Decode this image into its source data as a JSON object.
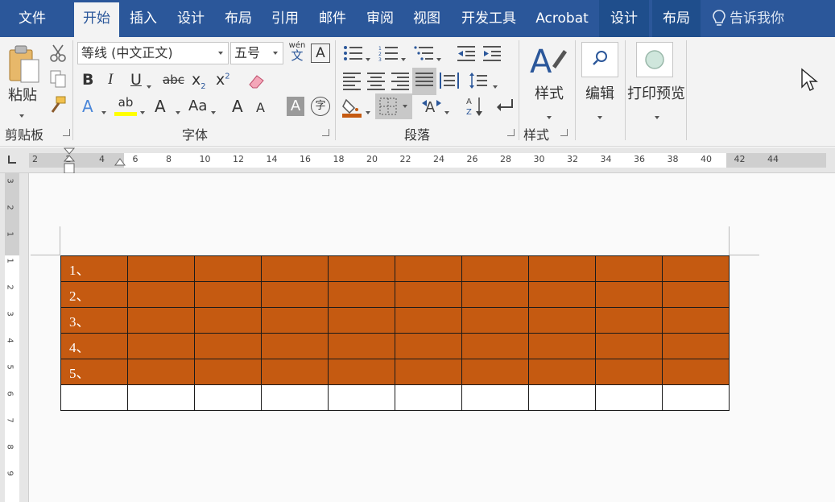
{
  "tabs": [
    {
      "label": "文件",
      "active": false
    },
    {
      "label": "开始",
      "active": true
    },
    {
      "label": "插入",
      "active": false
    },
    {
      "label": "设计",
      "active": false
    },
    {
      "label": "布局",
      "active": false
    },
    {
      "label": "引用",
      "active": false
    },
    {
      "label": "邮件",
      "active": false
    },
    {
      "label": "审阅",
      "active": false
    },
    {
      "label": "视图",
      "active": false
    },
    {
      "label": "开发工具",
      "active": false
    },
    {
      "label": "Acrobat",
      "active": false
    },
    {
      "label": "设计",
      "active": false
    },
    {
      "label": "布局",
      "active": false
    }
  ],
  "tell_me": "告诉我你",
  "clipboard": {
    "paste": "粘贴",
    "group": "剪贴板"
  },
  "font": {
    "name": "等线 (中文正文)",
    "size": "五号",
    "phonetic_top": "wén",
    "phonetic_bottom": "文",
    "border_char": "A",
    "bold": "B",
    "italic": "I",
    "underline": "U",
    "strike": "abc",
    "subscript": "x",
    "subscript_mark": "2",
    "superscript": "x",
    "superscript_mark": "2",
    "effects": "A",
    "highlight": "ab",
    "color": "A",
    "case": "Aa",
    "grow": "A",
    "shrink": "A",
    "shade": "A",
    "enclose": "字",
    "group": "字体"
  },
  "paragraph": {
    "group": "段落"
  },
  "styles": {
    "label": "样式",
    "group": "样式"
  },
  "editing": {
    "label": "编辑"
  },
  "print_preview": {
    "label": "打印预览"
  },
  "ruler": {
    "h_numbers": [
      "2",
      "2",
      "4",
      "6",
      "8",
      "10",
      "12",
      "14",
      "16",
      "18",
      "20",
      "22",
      "24",
      "26",
      "28",
      "30",
      "32",
      "34",
      "36",
      "38",
      "40",
      "42",
      "44"
    ],
    "v_numbers": [
      "3",
      "2",
      "1",
      "1",
      "2",
      "3",
      "4",
      "5",
      "6",
      "7",
      "8",
      "9"
    ]
  },
  "table": {
    "columns": 10,
    "rows": [
      "1、",
      "2、",
      "3、",
      "4、",
      "5、",
      ""
    ],
    "fill_color": "#c55a11",
    "filled_rows": 5
  },
  "colors": {
    "ribbon_blue": "#2b579a",
    "accent_orange": "#c55a11",
    "highlight_yellow": "#ffff00"
  }
}
